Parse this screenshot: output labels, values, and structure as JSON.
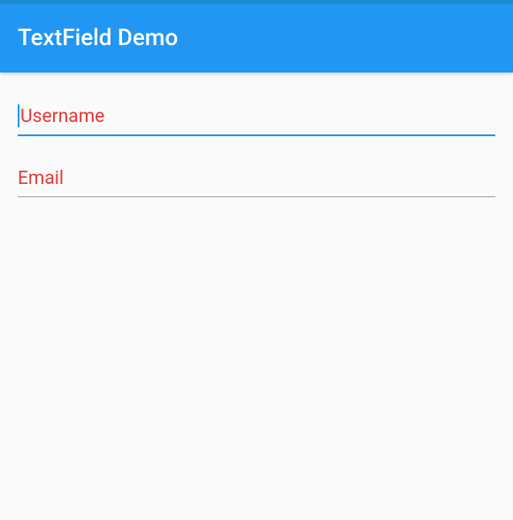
{
  "header": {
    "title": "TextField Demo"
  },
  "fields": {
    "username": {
      "placeholder": "Username",
      "value": ""
    },
    "email": {
      "placeholder": "Email",
      "value": ""
    }
  },
  "colors": {
    "primary": "#2196f3",
    "placeholder": "#e53935",
    "underline": "#9e9e9e"
  }
}
